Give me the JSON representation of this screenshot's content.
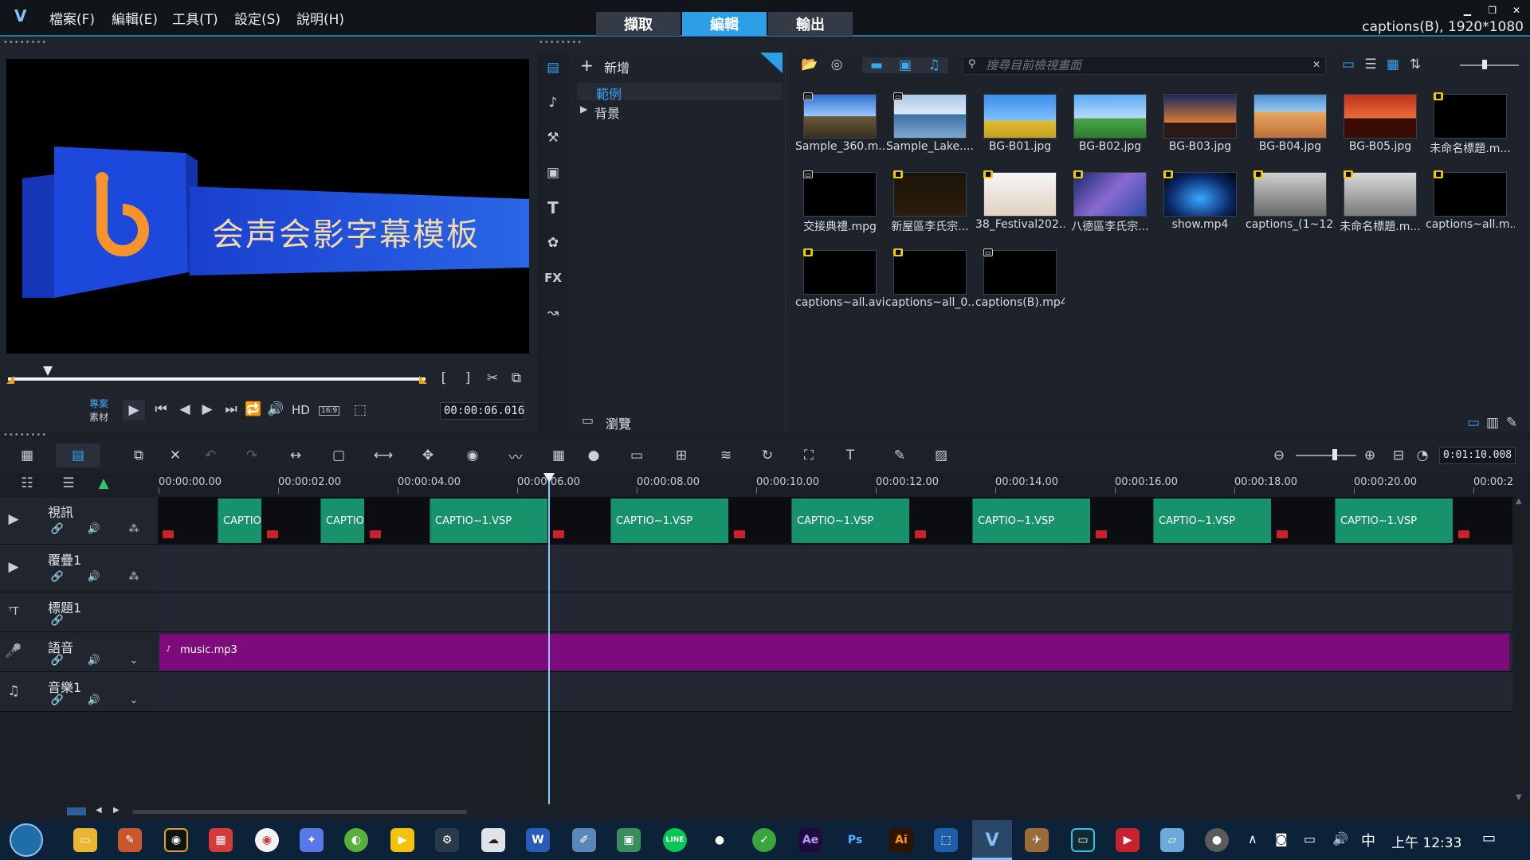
{
  "app": {
    "logo_glyph": "V",
    "menus": [
      "檔案(F)",
      "編輯(E)",
      "工具(T)",
      "設定(S)",
      "說明(H)"
    ],
    "mode_tabs": [
      "擷取",
      "編輯",
      "輸出"
    ],
    "active_tab": "編輯",
    "window_caption": "captions(B), 1920*1080"
  },
  "preview": {
    "title_text": "会声会影字幕模板",
    "mode_project": "專案",
    "mode_clip": "素材",
    "timecode": "00:00:06.016",
    "hd_label": "HD",
    "aspect_label": "16:9"
  },
  "library": {
    "add_label": "新增",
    "tree_items": [
      "範例",
      "背景"
    ],
    "browse_label": "瀏覽",
    "search_placeholder": "搜尋目前檢視畫面",
    "thumbs": [
      {
        "label": "Sample_360.m...",
        "kind": "video",
        "badge": "vid"
      },
      {
        "label": "Sample_Lake....",
        "kind": "video",
        "badge": "vid"
      },
      {
        "label": "BG-B01.jpg",
        "kind": "image",
        "badge": ""
      },
      {
        "label": "BG-B02.jpg",
        "kind": "image",
        "badge": ""
      },
      {
        "label": "BG-B03.jpg",
        "kind": "image",
        "badge": ""
      },
      {
        "label": "BG-B04.jpg",
        "kind": "image",
        "badge": ""
      },
      {
        "label": "BG-B05.jpg",
        "kind": "image",
        "badge": ""
      },
      {
        "label": "未命名標題.m...",
        "kind": "video",
        "badge": "yl"
      },
      {
        "label": "交接典禮.mpg",
        "kind": "video",
        "badge": "vid"
      },
      {
        "label": "新屋區李氏宗...",
        "kind": "video",
        "badge": "yl"
      },
      {
        "label": "38_Festival202...",
        "kind": "video",
        "badge": "yl"
      },
      {
        "label": "八德區李氏宗...",
        "kind": "video",
        "badge": "yl"
      },
      {
        "label": "show.mp4",
        "kind": "video",
        "badge": "yl"
      },
      {
        "label": "captions_(1~12...",
        "kind": "video",
        "badge": "yl"
      },
      {
        "label": "未命名標題.m...",
        "kind": "video",
        "badge": "yl"
      },
      {
        "label": "captions~all.m...",
        "kind": "video",
        "badge": "yl"
      },
      {
        "label": "captions~all.avi",
        "kind": "video",
        "badge": "yl"
      },
      {
        "label": "captions~all_0...",
        "kind": "video",
        "badge": "yl"
      },
      {
        "label": "captions(B).mp4",
        "kind": "video",
        "badge": "vid"
      }
    ]
  },
  "timeline": {
    "zoom_timecode": "0:01:10.008",
    "ruler": [
      "00:00:00.00",
      "00:00:02.00",
      "00:00:04.00",
      "00:00:06.00",
      "00:00:08.00",
      "00:00:10.00",
      "00:00:12.00",
      "00:00:14.00",
      "00:00:16.00",
      "00:00:18.00",
      "00:00:20.00",
      "00:00:2"
    ],
    "tracks": [
      "視訊",
      "覆疊1",
      "標題1",
      "語音",
      "音樂1"
    ],
    "clips": [
      {
        "label": "CAPTIO"
      },
      {
        "label": "CAPTIO"
      },
      {
        "label": "CAPTIO~1.VSP"
      },
      {
        "label": "CAPTIO~1.VSP"
      },
      {
        "label": "CAPTIO~1.VSP"
      },
      {
        "label": "CAPTIO~1.VSP"
      },
      {
        "label": "CAPTIO~1.VSP"
      },
      {
        "label": "CAPTIO~1.VSP"
      }
    ],
    "voice_clip": "music.mp3"
  },
  "taskbar": {
    "ime": "中",
    "clock": "上午 12:33"
  }
}
